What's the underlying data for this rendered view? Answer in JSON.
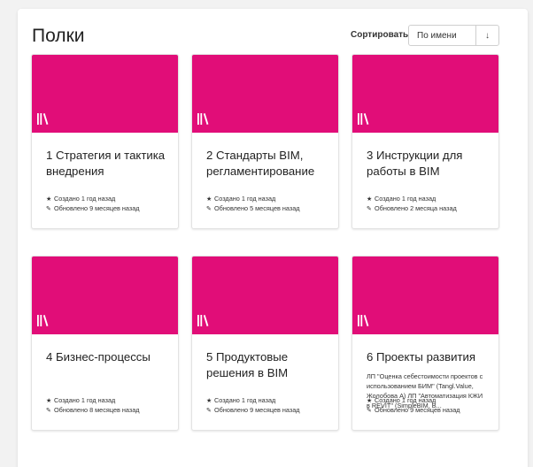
{
  "header": {
    "title": "Полки",
    "sort_label": "Сортировать",
    "sort_value": "По имени",
    "sort_direction_icon": "↓"
  },
  "colors": {
    "cover": "#e10d78"
  },
  "icons": {
    "cover": "library-books-icon",
    "created": "star-icon",
    "updated": "pencil-icon"
  },
  "shelves": [
    {
      "title": "1 Стратегия и тактика внедрения",
      "description": "",
      "created": "Создано 1 год назад",
      "updated": "Обновлено 9 месяцев назад"
    },
    {
      "title": "2 Стандарты BIM, регламентирование",
      "description": "",
      "created": "Создано 1 год назад",
      "updated": "Обновлено 5 месяцев назад"
    },
    {
      "title": "3 Инструкции для работы в BIM",
      "description": "",
      "created": "Создано 1 год назад",
      "updated": "Обновлено 2 месяца назад"
    },
    {
      "title": "4 Бизнес-процессы",
      "description": "",
      "created": "Создано 1 год назад",
      "updated": "Обновлено 8 месяцев назад"
    },
    {
      "title": "5 Продуктовые решения в BIM",
      "description": "",
      "created": "Создано 1 год назад",
      "updated": "Обновлено 9 месяцев назад"
    },
    {
      "title": "6 Проекты развития",
      "description": "ЛП \"Оценка себестоимости проектов с использованием БИМ\" (Tangl.Value, Жолобова А) ЛП \"Автоматизация КЖИ в REVIT\" (SimpleBIM, В...",
      "created": "Создано 1 год назад",
      "updated": "Обновлено 9 месяцев назад"
    }
  ]
}
